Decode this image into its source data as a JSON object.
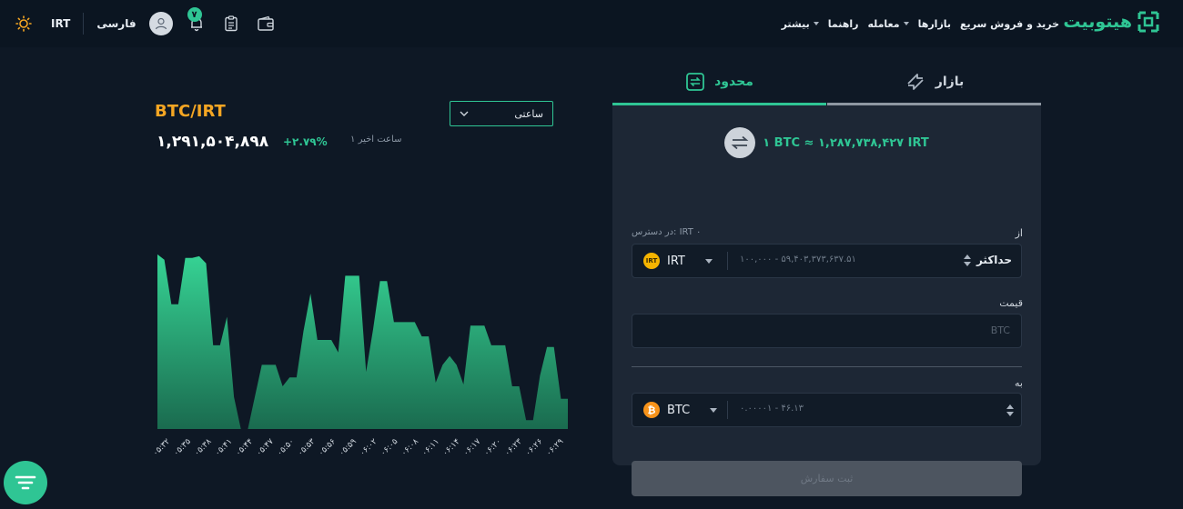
{
  "header": {
    "currency": "IRT",
    "language": "فارسی",
    "notification_count": "۷",
    "brand": "هیتوبیت",
    "nav": [
      {
        "label": "خرید و فروش سریع"
      },
      {
        "label": "بازارها"
      },
      {
        "label": "معامله",
        "dropdown": true
      },
      {
        "label": "راهنما"
      },
      {
        "label": "بیشتر",
        "dropdown": true
      }
    ],
    "icons": [
      "sun-icon",
      "user-icon",
      "bell-icon",
      "orders-icon",
      "wallet-icon"
    ]
  },
  "market": {
    "pair": "BTC/IRT",
    "price": "۱,۲۹۱,۵۰۴,۸۹۸",
    "change": "+۲.۷۹%",
    "period_label": "۱ ساعت اخیر",
    "timeframe": "ساعتی"
  },
  "chart_data": {
    "type": "area",
    "color": "#2fc594",
    "x": [
      "۰۵:۳۲",
      "۰۵:۳۵",
      "۰۵:۳۸",
      "۰۵:۴۱",
      "۰۵:۴۴",
      "۰۵:۴۷",
      "۰۵:۵۰",
      "۰۵:۵۳",
      "۰۵:۵۶",
      "۰۵:۵۹",
      "۰۶:۰۲",
      "۰۶:۰۵",
      "۰۶:۰۸",
      "۰۶:۱۱",
      "۰۶:۱۴",
      "۰۶:۱۷",
      "۰۶:۲۰",
      "۰۶:۲۳",
      "۰۶:۲۶",
      "۰۶:۲۹"
    ],
    "values": [
      0.98,
      0.95,
      0.7,
      0.7,
      0.96,
      0.96,
      0.97,
      0.93,
      0.47,
      0.47,
      0.63,
      0.18,
      0.0,
      0.0,
      0.18,
      0.36,
      0.36,
      0.36,
      0.24,
      0.29,
      0.29,
      0.55,
      0.76,
      0.5,
      0.5,
      0.5,
      0.43,
      0.86,
      0.86,
      0.86,
      0.32,
      0.56,
      0.83,
      0.83,
      0.6,
      0.6,
      0.6,
      0.6,
      0.52,
      0.52,
      0.26,
      0.36,
      0.41,
      0.36,
      0.25,
      0.58,
      0.58,
      0.58,
      0.47,
      0.47,
      0.47,
      0.24,
      0.24,
      0.05,
      0.05,
      0.3,
      0.46,
      0.46,
      0.17,
      0.17
    ]
  },
  "order": {
    "tabs": {
      "market": "بازار",
      "limit": "محدود"
    },
    "rate": "۱ BTC ≈ ۱,۲۸۷,۷۳۸,۴۲۷ IRT",
    "from": {
      "label": "از",
      "available": "در دسترس: IRT ۰",
      "asset": "IRT",
      "coin_badge": "IRT",
      "range": "۱۰۰,۰۰۰ - ۵۹,۴۰۳,۳۷۳,۶۳۷.۵۱",
      "max": "حداکثر"
    },
    "price": {
      "label": "قیمت",
      "placeholder": "BTC"
    },
    "to": {
      "label": "به",
      "asset": "BTC",
      "coin_badge": "₿",
      "range": "۰.۰۰۰۰۱ - ۴۶.۱۳"
    },
    "submit": "ثبت سفارش"
  }
}
